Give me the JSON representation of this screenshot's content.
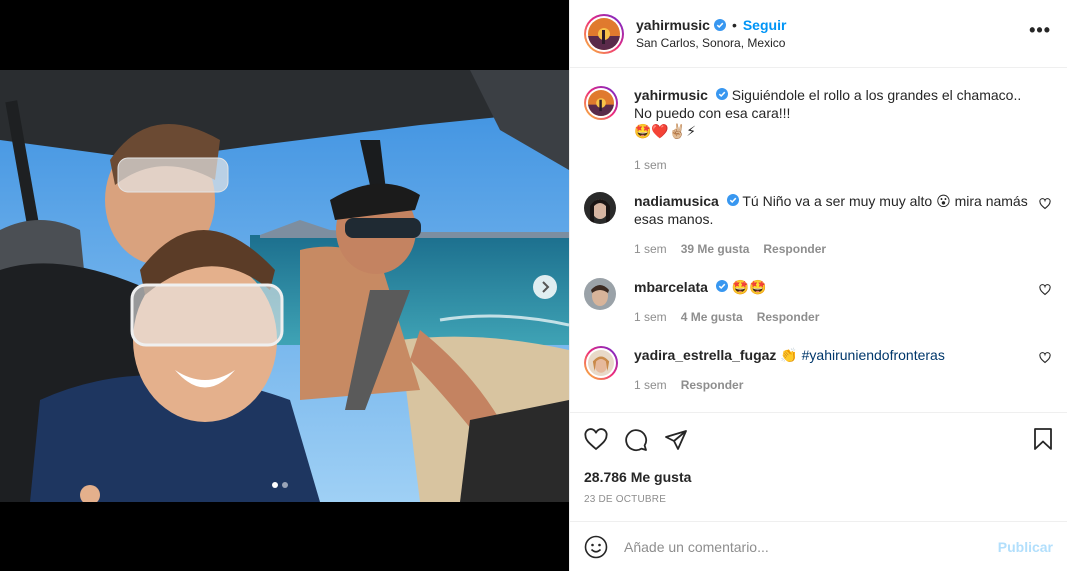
{
  "post": {
    "username": "yahirmusic",
    "follow_label": "Seguir",
    "separator": "•",
    "location": "San Carlos, Sonora, Mexico",
    "more_label": "•••"
  },
  "caption": {
    "username": "yahirmusic",
    "text": "Siguiéndole el rollo a los grandes el chamaco.. No puedo con esa cara!!!",
    "emojis": "🤩❤️✌🏼⚡",
    "time": "1 sem"
  },
  "comments": [
    {
      "username": "nadiamusica",
      "verified": true,
      "text": "Tú Niño va a ser muy muy alto 😮 mira namás esas manos.",
      "time": "1 sem",
      "likes": "39 Me gusta",
      "reply": "Responder"
    },
    {
      "username": "mbarcelata",
      "verified": true,
      "text": "🤩🤩",
      "time": "1 sem",
      "likes": "4 Me gusta",
      "reply": "Responder"
    },
    {
      "username": "yadira_estrella_fugaz",
      "verified": false,
      "text_prefix": "👏 ",
      "hashtag": "#yahiruniendofronteras",
      "time": "1 sem",
      "reply": "Responder"
    }
  ],
  "stats": {
    "likes": "28.786 Me gusta",
    "date": "23 DE OCTUBRE"
  },
  "add_comment": {
    "placeholder": "Añade un comentario...",
    "publish_label": "Publicar"
  },
  "colors": {
    "accent": "#0095f6",
    "verified": "#3897f0",
    "publish_disabled": "#b2dffc"
  },
  "carousel": {
    "total": 2,
    "active": 1
  }
}
